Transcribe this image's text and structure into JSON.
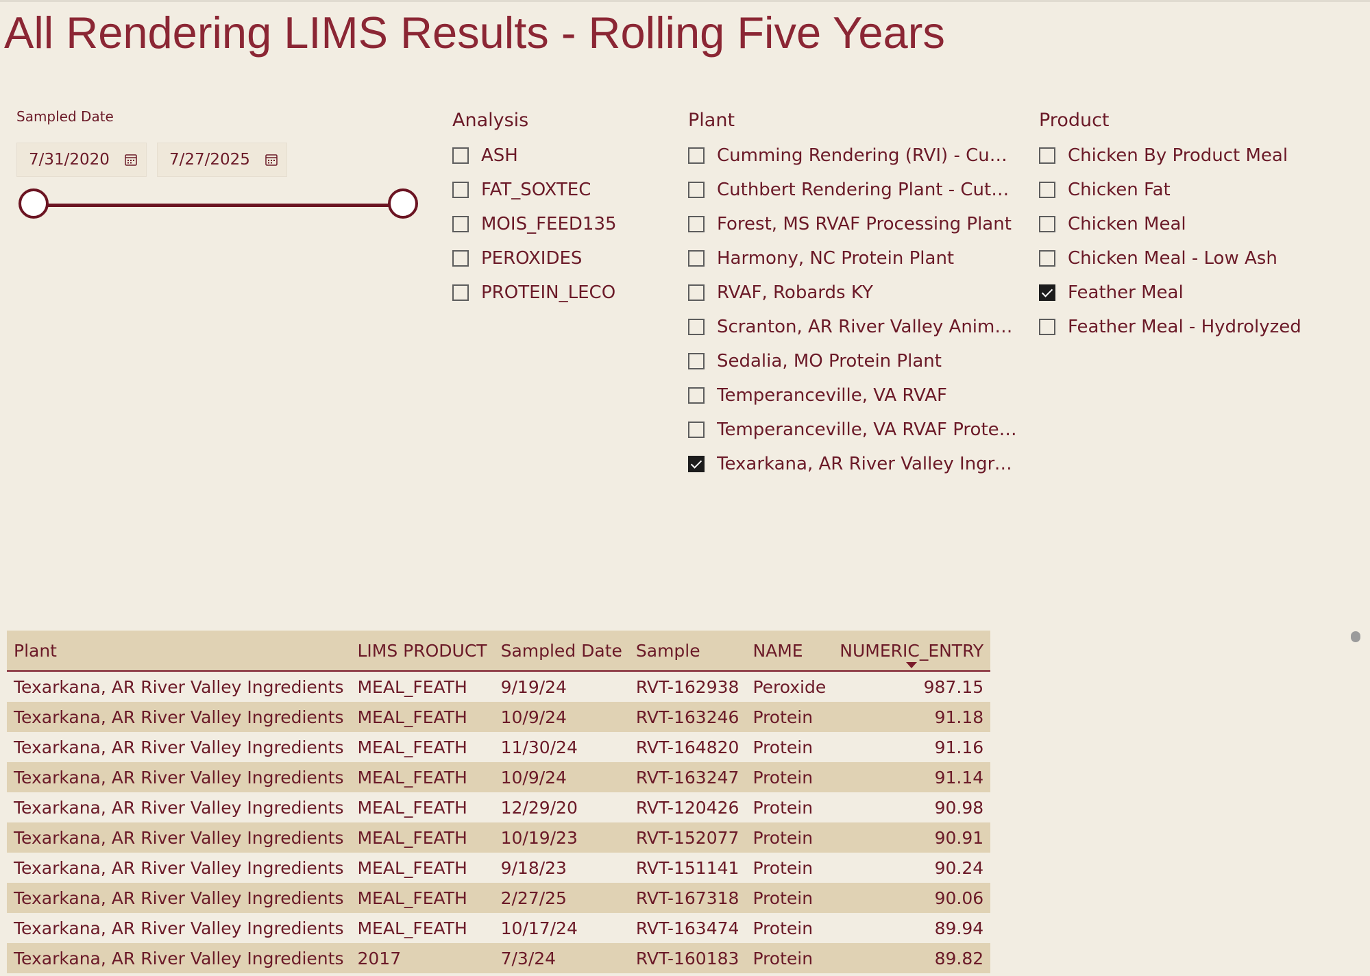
{
  "page": {
    "title": "All Rendering LIMS Results - Rolling Five Years"
  },
  "date_slicer": {
    "label": "Sampled Date",
    "start": "7/31/2020",
    "end": "7/27/2025",
    "start_icon": "calendar-icon",
    "end_icon": "calendar-icon"
  },
  "analysis_slicer": {
    "header": "Analysis",
    "items": [
      {
        "label": "ASH",
        "checked": false
      },
      {
        "label": "FAT_SOXTEC",
        "checked": false
      },
      {
        "label": "MOIS_FEED135",
        "checked": false
      },
      {
        "label": "PEROXIDES",
        "checked": false
      },
      {
        "label": "PROTEIN_LECO",
        "checked": false
      }
    ]
  },
  "plant_slicer": {
    "header": "Plant",
    "items": [
      {
        "label": "Cumming Rendering (RVI) - Cumm...",
        "checked": false
      },
      {
        "label": "Cuthbert Rendering Plant - Cuthbe...",
        "checked": false
      },
      {
        "label": "Forest, MS RVAF Processing Plant",
        "checked": false
      },
      {
        "label": "Harmony, NC Protein Plant",
        "checked": false
      },
      {
        "label": "RVAF, Robards KY",
        "checked": false
      },
      {
        "label": "Scranton, AR River Valley Animal F...",
        "checked": false
      },
      {
        "label": "Sedalia, MO Protein Plant",
        "checked": false
      },
      {
        "label": "Temperanceville, VA RVAF",
        "checked": false
      },
      {
        "label": "Temperanceville, VA RVAF Protein ...",
        "checked": false
      },
      {
        "label": "Texarkana, AR River Valley Ingredie...",
        "checked": true
      }
    ]
  },
  "product_slicer": {
    "header": "Product",
    "items": [
      {
        "label": "Chicken By Product Meal",
        "checked": false
      },
      {
        "label": "Chicken Fat",
        "checked": false
      },
      {
        "label": "Chicken Meal",
        "checked": false
      },
      {
        "label": "Chicken Meal - Low Ash",
        "checked": false
      },
      {
        "label": "Feather Meal",
        "checked": true
      },
      {
        "label": "Feather Meal - Hydrolyzed",
        "checked": false
      }
    ]
  },
  "table": {
    "columns": [
      "Plant",
      "LIMS PRODUCT",
      "Sampled Date",
      "Sample",
      "NAME",
      "NUMERIC_ENTRY"
    ],
    "sort_column": "NUMERIC_ENTRY",
    "sort_direction": "descending",
    "rows": [
      [
        "Texarkana, AR River Valley Ingredients",
        "MEAL_FEATH",
        "9/19/24",
        "RVT-162938",
        "Peroxide",
        "987.15"
      ],
      [
        "Texarkana, AR River Valley Ingredients",
        "MEAL_FEATH",
        "10/9/24",
        "RVT-163246",
        "Protein",
        "91.18"
      ],
      [
        "Texarkana, AR River Valley Ingredients",
        "MEAL_FEATH",
        "11/30/24",
        "RVT-164820",
        "Protein",
        "91.16"
      ],
      [
        "Texarkana, AR River Valley Ingredients",
        "MEAL_FEATH",
        "10/9/24",
        "RVT-163247",
        "Protein",
        "91.14"
      ],
      [
        "Texarkana, AR River Valley Ingredients",
        "MEAL_FEATH",
        "12/29/20",
        "RVT-120426",
        "Protein",
        "90.98"
      ],
      [
        "Texarkana, AR River Valley Ingredients",
        "MEAL_FEATH",
        "10/19/23",
        "RVT-152077",
        "Protein",
        "90.91"
      ],
      [
        "Texarkana, AR River Valley Ingredients",
        "MEAL_FEATH",
        "9/18/23",
        "RVT-151141",
        "Protein",
        "90.24"
      ],
      [
        "Texarkana, AR River Valley Ingredients",
        "MEAL_FEATH",
        "2/27/25",
        "RVT-167318",
        "Protein",
        "90.06"
      ],
      [
        "Texarkana, AR River Valley Ingredients",
        "MEAL_FEATH",
        "10/17/24",
        "RVT-163474",
        "Protein",
        "89.94"
      ],
      [
        "Texarkana, AR River Valley Ingredients",
        "2017",
        "7/3/24",
        "RVT-160183",
        "Protein",
        "89.82"
      ]
    ]
  },
  "colors": {
    "background": "#f2ede2",
    "title": "#8b2634",
    "accent": "#6b1422",
    "row_band": "#e0d2b4"
  }
}
